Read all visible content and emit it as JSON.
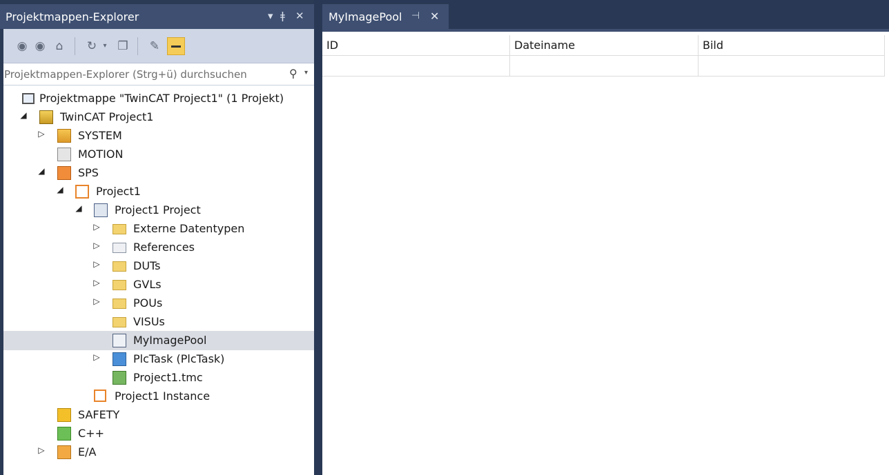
{
  "explorer": {
    "title": "Projektmappen-Explorer",
    "title_controls": [
      "▾",
      "ǂ",
      "✕"
    ],
    "search_placeholder": "Projektmappen-Explorer (Strg+ü) durchsuchen",
    "tree": [
      {
        "label": "Projektmappe \"TwinCAT Project1\" (1 Projekt)",
        "icon": "solution-icon",
        "arrow": ""
      },
      {
        "label": "TwinCAT Project1",
        "icon": "twincat-project-icon",
        "arrow": "◢"
      },
      {
        "label": "SYSTEM",
        "icon": "system-icon",
        "arrow": "▷"
      },
      {
        "label": "MOTION",
        "icon": "motion-icon",
        "arrow": ""
      },
      {
        "label": "SPS",
        "icon": "sps-icon",
        "arrow": "◢"
      },
      {
        "label": "Project1",
        "icon": "plc-project-icon",
        "arrow": "◢"
      },
      {
        "label": "Project1 Project",
        "icon": "plc-project-file-icon",
        "arrow": "◢"
      },
      {
        "label": "Externe Datentypen",
        "icon": "folder-icon",
        "arrow": "▷"
      },
      {
        "label": "References",
        "icon": "references-icon",
        "arrow": "▷"
      },
      {
        "label": "DUTs",
        "icon": "folder-icon",
        "arrow": "▷"
      },
      {
        "label": "GVLs",
        "icon": "folder-icon",
        "arrow": "▷"
      },
      {
        "label": "POUs",
        "icon": "folder-icon",
        "arrow": "▷"
      },
      {
        "label": "VISUs",
        "icon": "folder-icon",
        "arrow": ""
      },
      {
        "label": "MyImagePool",
        "icon": "image-pool-icon",
        "arrow": ""
      },
      {
        "label": "PlcTask (PlcTask)",
        "icon": "plc-task-icon",
        "arrow": "▷"
      },
      {
        "label": "Project1.tmc",
        "icon": "tmc-file-icon",
        "arrow": ""
      },
      {
        "label": "Project1 Instance",
        "icon": "instance-icon",
        "arrow": ""
      },
      {
        "label": "SAFETY",
        "icon": "safety-icon",
        "arrow": ""
      },
      {
        "label": "C++",
        "icon": "cpp-icon",
        "arrow": ""
      },
      {
        "label": "E/A",
        "icon": "io-icon",
        "arrow": "▷"
      }
    ],
    "selected": "MyImagePool"
  },
  "document": {
    "tab_label": "MyImagePool",
    "grid_headers": [
      "ID",
      "Dateiname",
      "Bild"
    ],
    "grid_rows": [
      [
        "",
        "",
        ""
      ]
    ]
  }
}
